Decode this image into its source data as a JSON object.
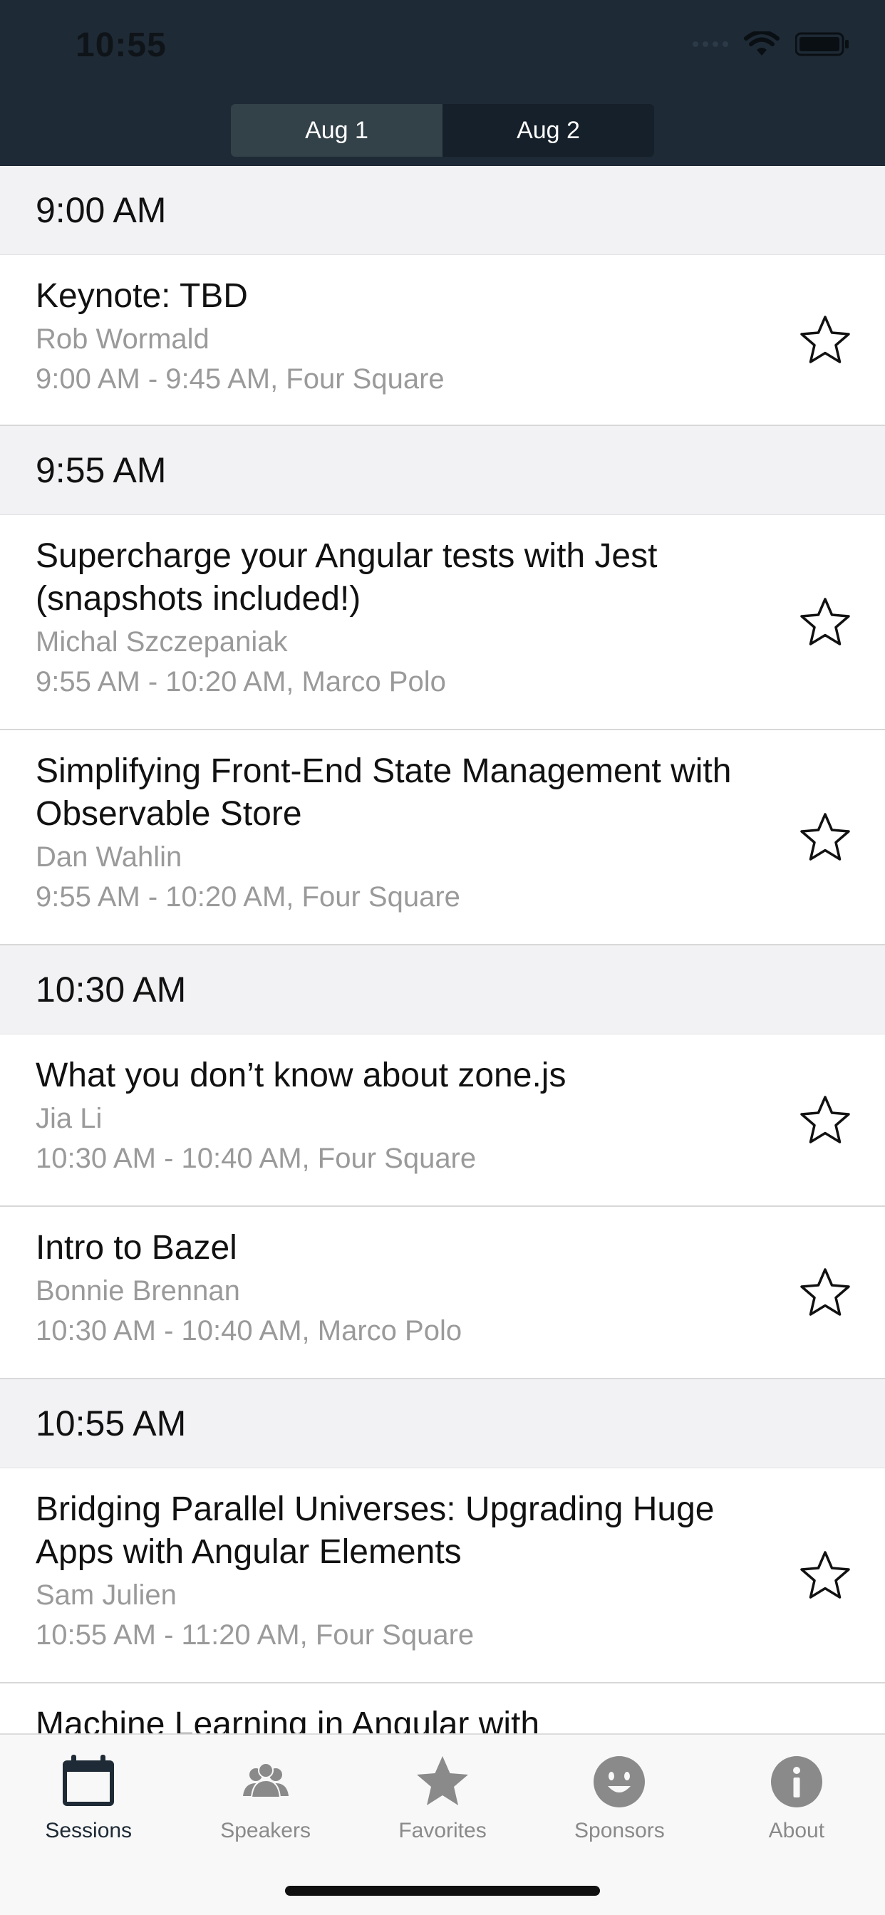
{
  "status_bar": {
    "time": "10:55"
  },
  "segmented": [
    {
      "label": "Aug 1",
      "selected": true
    },
    {
      "label": "Aug 2",
      "selected": false
    }
  ],
  "schedule": [
    {
      "time": "9:00 AM",
      "sessions": [
        {
          "title": "Keynote: TBD",
          "speaker": "Rob Wormald",
          "time_location": "9:00 AM - 9:45 AM, Four Square"
        }
      ]
    },
    {
      "time": "9:55 AM",
      "sessions": [
        {
          "title": "Supercharge your Angular tests with Jest (snapshots included!)",
          "speaker": "Michal Szczepaniak",
          "time_location": "9:55 AM - 10:20 AM, Marco Polo"
        },
        {
          "title": "Simplifying Front-End State Management with Observable Store",
          "speaker": "Dan Wahlin",
          "time_location": "9:55 AM - 10:20 AM, Four Square"
        }
      ]
    },
    {
      "time": "10:30 AM",
      "sessions": [
        {
          "title": "What you don’t know about zone.js",
          "speaker": "Jia Li",
          "time_location": "10:30 AM - 10:40 AM, Four Square"
        },
        {
          "title": "Intro to Bazel",
          "speaker": "Bonnie Brennan",
          "time_location": "10:30 AM - 10:40 AM, Marco Polo"
        }
      ]
    },
    {
      "time": "10:55 AM",
      "sessions": [
        {
          "title": "Bridging Parallel Universes: Upgrading Huge Apps with Angular Elements",
          "speaker": "Sam Julien",
          "time_location": "10:55 AM - 11:20 AM, Four Square"
        },
        {
          "title": "Machine Learning in Angular with",
          "speaker": "",
          "time_location": ""
        }
      ]
    }
  ],
  "tabbar": [
    {
      "label": "Sessions",
      "icon": "calendar-icon",
      "active": true
    },
    {
      "label": "Speakers",
      "icon": "people-icon",
      "active": false
    },
    {
      "label": "Favorites",
      "icon": "star-icon",
      "active": false
    },
    {
      "label": "Sponsors",
      "icon": "smiley-icon",
      "active": false
    },
    {
      "label": "About",
      "icon": "info-icon",
      "active": false
    }
  ],
  "colors": {
    "header_bg": "#1e2a35",
    "section_bg": "#f2f2f4",
    "secondary_text": "#9a9a9a",
    "tab_active": "#1e2a35",
    "tab_inactive": "#8a8a8a"
  }
}
